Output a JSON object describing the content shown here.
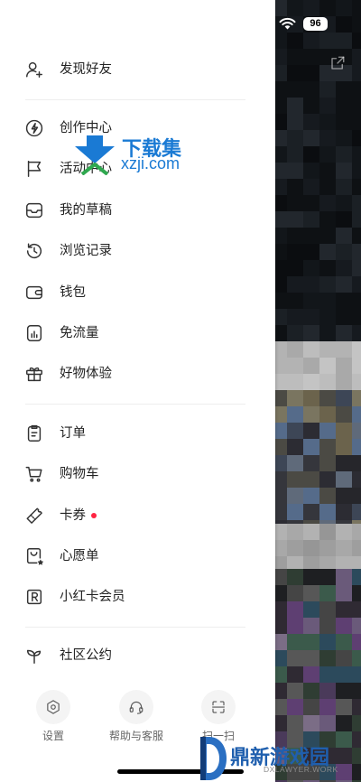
{
  "status_bar": {
    "battery": "96",
    "wifi_icon": "wifi-icon"
  },
  "top_right": {
    "icon": "external-link-icon"
  },
  "drawer": {
    "groups": [
      {
        "items": [
          {
            "icon": "person-add-icon",
            "label": "发现好友"
          }
        ]
      },
      {
        "items": [
          {
            "icon": "lightning-icon",
            "label": "创作中心"
          },
          {
            "icon": "flag-icon",
            "label": "活动中心"
          },
          {
            "icon": "drafts-icon",
            "label": "我的草稿"
          },
          {
            "icon": "history-icon",
            "label": "浏览记录"
          },
          {
            "icon": "wallet-icon",
            "label": "钱包"
          },
          {
            "icon": "data-free-icon",
            "label": "免流量"
          },
          {
            "icon": "gift-icon",
            "label": "好物体验"
          }
        ]
      },
      {
        "items": [
          {
            "icon": "clipboard-icon",
            "label": "订单"
          },
          {
            "icon": "cart-icon",
            "label": "购物车"
          },
          {
            "icon": "ticket-icon",
            "label": "卡券",
            "badge_dot": true
          },
          {
            "icon": "wishlist-icon",
            "label": "心愿单"
          },
          {
            "icon": "r-card-icon",
            "label": "小红卡会员"
          }
        ]
      },
      {
        "items": [
          {
            "icon": "sprout-icon",
            "label": "社区公约"
          }
        ]
      }
    ],
    "bottom_actions": [
      {
        "icon": "gear-icon",
        "label": "设置"
      },
      {
        "icon": "headset-icon",
        "label": "帮助与客服"
      },
      {
        "icon": "scan-icon",
        "label": "扫一扫"
      }
    ]
  },
  "watermarks": [
    {
      "brand": "下载集",
      "url": "xzji.com"
    },
    {
      "brand": "鼎新游戏园",
      "url": "DXLAWYER.WORK"
    }
  ],
  "colors": {
    "badge_red": "#ff2442",
    "text": "#222222",
    "watermark_blue": "#1a7ad4",
    "watermark_navy": "#1f5fae"
  }
}
